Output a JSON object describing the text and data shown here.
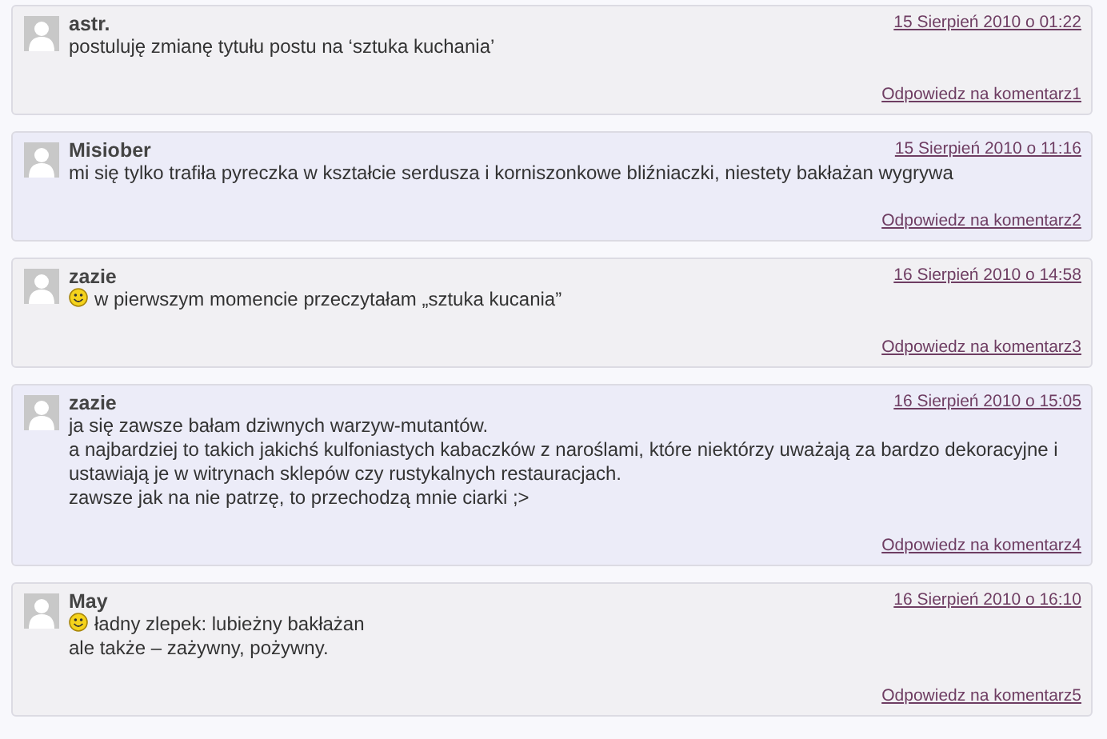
{
  "comments": [
    {
      "author": "astr.",
      "date": "15 Sierpień 2010 o 01:22",
      "color": "#f1f0f3",
      "paragraphs": [
        {
          "text": "postuluję zmianę tytułu postu na ‘sztuka kuchania’",
          "smiley": false
        }
      ],
      "reply": "Odpowiedz na komentarz1"
    },
    {
      "author": "Misiober",
      "date": "15 Sierpień 2010 o 11:16",
      "color": "#ececf8",
      "paragraphs": [
        {
          "text": "mi się tylko trafiła pyreczka w kształcie serdusza i korniszonkowe bliźniaczki, niestety bakłażan wygrywa",
          "smiley": false
        }
      ],
      "reply": "Odpowiedz na komentarz2"
    },
    {
      "author": "zazie",
      "date": "16 Sierpień 2010 o 14:58",
      "color": "#f1f0f3",
      "paragraphs": [
        {
          "text": "w pierwszym momencie przeczytałam „sztuka kucania”",
          "smiley": true
        }
      ],
      "reply": "Odpowiedz na komentarz3"
    },
    {
      "author": "zazie",
      "date": "16 Sierpień 2010 o 15:05",
      "color": "#ececf8",
      "paragraphs": [
        {
          "text": "ja się zawsze bałam dziwnych warzyw-mutantów.",
          "smiley": false
        },
        {
          "text": "a najbardziej to takich jakichś kulfoniastych kabaczków z naroślami, które niektórzy uważają za bardzo dekoracyjne i ustawiają je w witrynach sklepów czy rustykalnych restauracjach.",
          "smiley": false
        },
        {
          "text": "zawsze jak na nie patrzę, to przechodzą mnie ciarki ;>",
          "smiley": false
        }
      ],
      "reply": "Odpowiedz na komentarz4"
    },
    {
      "author": "May",
      "date": "16 Sierpień 2010 o 16:10",
      "color": "#f1f0f3",
      "paragraphs": [
        {
          "text": "ładny zlepek: lubieżny bakłażan",
          "smiley": true
        },
        {
          "text": "ale także – zażywny, pożywny.",
          "smiley": false
        }
      ],
      "reply": "Odpowiedz na komentarz5"
    }
  ]
}
